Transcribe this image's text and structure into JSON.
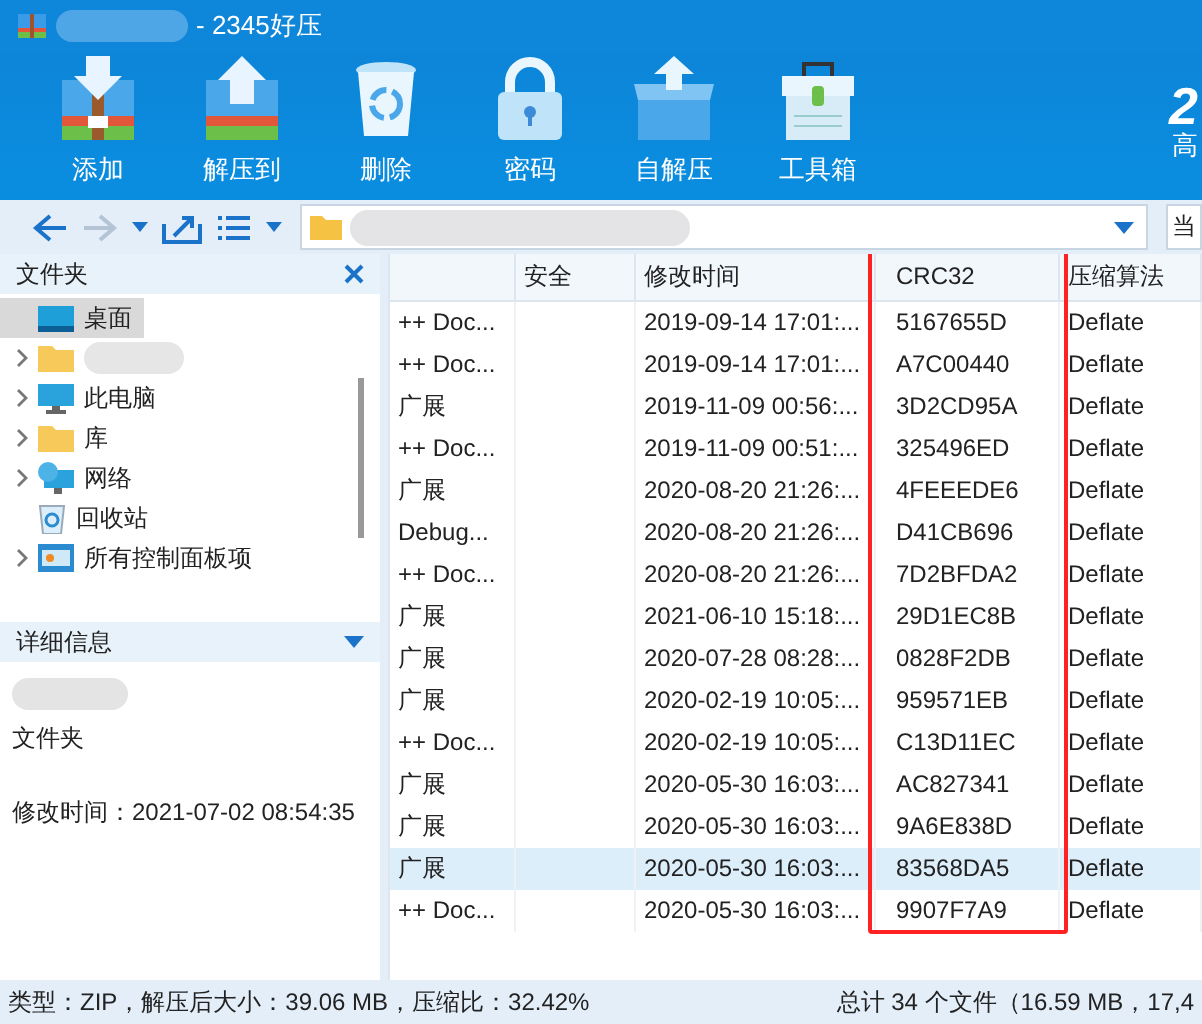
{
  "window": {
    "title": "- 2345好压"
  },
  "toolbar": {
    "buttons": [
      {
        "label": "添加"
      },
      {
        "label": "解压到"
      },
      {
        "label": "删除"
      },
      {
        "label": "密码"
      },
      {
        "label": "自解压"
      },
      {
        "label": "工具箱"
      }
    ],
    "brand": [
      "2",
      "高"
    ]
  },
  "nav": {
    "side_box": "当"
  },
  "folders_panel": {
    "title": "文件夹",
    "items": [
      {
        "label": "桌面",
        "kind": "desktop",
        "expandable": false,
        "selected": true
      },
      {
        "kind": "folder",
        "expandable": true,
        "selected": false
      },
      {
        "label": "此电脑",
        "kind": "computer",
        "expandable": true,
        "selected": false
      },
      {
        "label": "库",
        "kind": "folder",
        "expandable": true,
        "selected": false
      },
      {
        "label": "网络",
        "kind": "network",
        "expandable": true,
        "selected": false
      },
      {
        "label": "回收站",
        "kind": "recycle",
        "expandable": false,
        "selected": false
      },
      {
        "label": "所有控制面板项",
        "kind": "control",
        "expandable": true,
        "selected": false
      }
    ]
  },
  "details_panel": {
    "title": "详细信息",
    "type": "文件夹",
    "modified": "修改时间：2021-07-02 08:54:35"
  },
  "table": {
    "columns": [
      "",
      "安全",
      "修改时间",
      "CRC32",
      "压缩算法"
    ],
    "rows": [
      {
        "cells": [
          "++ Doc...",
          "",
          "2019-09-14 17:01:...",
          "5167655D",
          "Deflate"
        ],
        "selected": false
      },
      {
        "cells": [
          "++ Doc...",
          "",
          "2019-09-14 17:01:...",
          "A7C00440",
          "Deflate"
        ],
        "selected": false
      },
      {
        "cells": [
          "广展",
          "",
          "2019-11-09 00:56:...",
          "3D2CD95A",
          "Deflate"
        ],
        "selected": false
      },
      {
        "cells": [
          "++ Doc...",
          "",
          "2019-11-09 00:51:...",
          "325496ED",
          "Deflate"
        ],
        "selected": false
      },
      {
        "cells": [
          "广展",
          "",
          "2020-08-20 21:26:...",
          "4FEEEDE6",
          "Deflate"
        ],
        "selected": false
      },
      {
        "cells": [
          "Debug...",
          "",
          "2020-08-20 21:26:...",
          "D41CB696",
          "Deflate"
        ],
        "selected": false
      },
      {
        "cells": [
          "++ Doc...",
          "",
          "2020-08-20 21:26:...",
          "7D2BFDA2",
          "Deflate"
        ],
        "selected": false
      },
      {
        "cells": [
          "广展",
          "",
          "2021-06-10 15:18:...",
          "29D1EC8B",
          "Deflate"
        ],
        "selected": false
      },
      {
        "cells": [
          "广展",
          "",
          "2020-07-28 08:28:...",
          "0828F2DB",
          "Deflate"
        ],
        "selected": false
      },
      {
        "cells": [
          "广展",
          "",
          "2020-02-19 10:05:...",
          "959571EB",
          "Deflate"
        ],
        "selected": false
      },
      {
        "cells": [
          "++ Doc...",
          "",
          "2020-02-19 10:05:...",
          "C13D11EC",
          "Deflate"
        ],
        "selected": false
      },
      {
        "cells": [
          "广展",
          "",
          "2020-05-30 16:03:...",
          "AC827341",
          "Deflate"
        ],
        "selected": false
      },
      {
        "cells": [
          "广展",
          "",
          "2020-05-30 16:03:...",
          "9A6E838D",
          "Deflate"
        ],
        "selected": false
      },
      {
        "cells": [
          "广展",
          "",
          "2020-05-30 16:03:...",
          "83568DA5",
          "Deflate"
        ],
        "selected": true
      },
      {
        "cells": [
          "++ Doc...",
          "",
          "2020-05-30 16:03:...",
          "9907F7A9",
          "Deflate"
        ],
        "selected": false
      }
    ]
  },
  "status_bar": {
    "left": "类型：ZIP，解压后大小：39.06 MB，压缩比：32.42%",
    "right": "总计 34 个文件（16.59 MB，17,4"
  }
}
